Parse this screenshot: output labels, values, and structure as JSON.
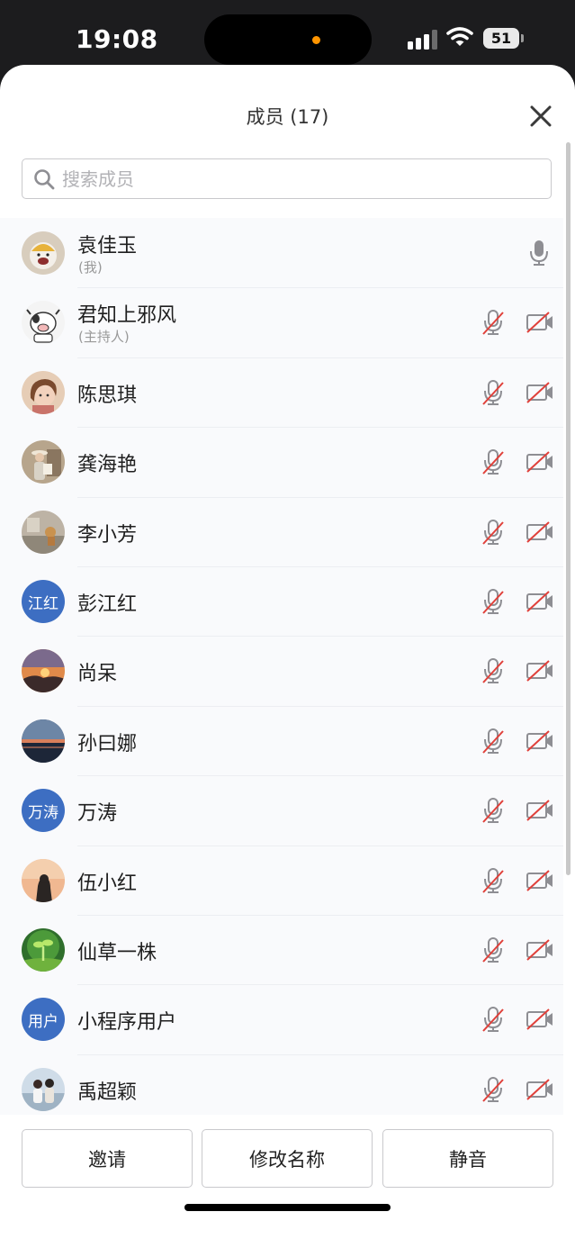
{
  "status_bar": {
    "time": "19:08",
    "battery": "51"
  },
  "header": {
    "title": "成员 (17)"
  },
  "search": {
    "placeholder": "搜索成员"
  },
  "members": [
    {
      "name": "袁佳玉",
      "sub": "(我)",
      "avatar": "photo-puppy",
      "mic": "on",
      "camera": "hidden"
    },
    {
      "name": "君知上邪风",
      "sub": "(主持人)",
      "avatar": "photo-cartoon-cow",
      "mic": "muted",
      "camera": "off"
    },
    {
      "name": "陈思琪",
      "sub": "",
      "avatar": "photo-child",
      "mic": "muted",
      "camera": "off"
    },
    {
      "name": "龚海艳",
      "sub": "",
      "avatar": "photo-woman-hat",
      "mic": "muted",
      "camera": "off"
    },
    {
      "name": "李小芳",
      "sub": "",
      "avatar": "photo-room",
      "mic": "muted",
      "camera": "off"
    },
    {
      "name": "彭江红",
      "sub": "",
      "avatar": "text",
      "avatar_text": "江红",
      "mic": "muted",
      "camera": "off"
    },
    {
      "name": "尚呆",
      "sub": "",
      "avatar": "photo-sunset",
      "mic": "muted",
      "camera": "off"
    },
    {
      "name": "孙曰娜",
      "sub": "",
      "avatar": "photo-lake-dusk",
      "mic": "muted",
      "camera": "off"
    },
    {
      "name": "万涛",
      "sub": "",
      "avatar": "text",
      "avatar_text": "万涛",
      "mic": "muted",
      "camera": "off"
    },
    {
      "name": "伍小红",
      "sub": "",
      "avatar": "photo-woman-beach",
      "mic": "muted",
      "camera": "off"
    },
    {
      "name": "仙草一株",
      "sub": "",
      "avatar": "photo-sprout",
      "mic": "muted",
      "camera": "off"
    },
    {
      "name": "小程序用户",
      "sub": "",
      "avatar": "text",
      "avatar_text": "用户",
      "mic": "muted",
      "camera": "off"
    },
    {
      "name": "禹超颖",
      "sub": "",
      "avatar": "photo-couple",
      "mic": "muted",
      "camera": "off"
    }
  ],
  "actions": {
    "invite": "邀请",
    "rename": "修改名称",
    "mute": "静音"
  },
  "colors": {
    "accent": "#3d6ec2",
    "muted_slash": "#e0403a",
    "icon_gray": "#8e8e93"
  }
}
